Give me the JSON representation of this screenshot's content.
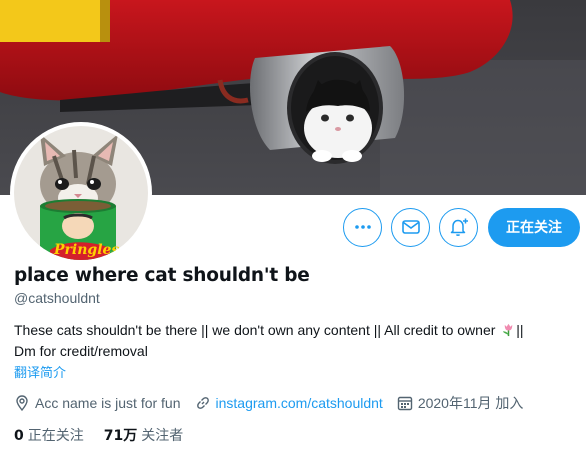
{
  "profile": {
    "display_name": "place where cat shouldn't be",
    "handle": "@catshouldnt",
    "bio": "These cats shouldn't be there || we don't own any content || All credit to owner",
    "bio_end": "||",
    "bio_line2": "Dm for credit/removal",
    "translate_label": "翻译简介",
    "location": "Acc name is just for fun",
    "website": "instagram.com/catshouldnt",
    "joined": "2020年11月 加入"
  },
  "actions": {
    "following_label": "正在关注",
    "icons": [
      "more-icon",
      "mail-icon",
      "notification-bell-icon"
    ]
  },
  "stats": {
    "following_count": "0",
    "following_label": "正在关注",
    "followers_count": "71万",
    "followers_label": "关注者"
  },
  "colors": {
    "accent": "#1d9bf0",
    "text": "#0f1419",
    "secondary": "#536471"
  }
}
